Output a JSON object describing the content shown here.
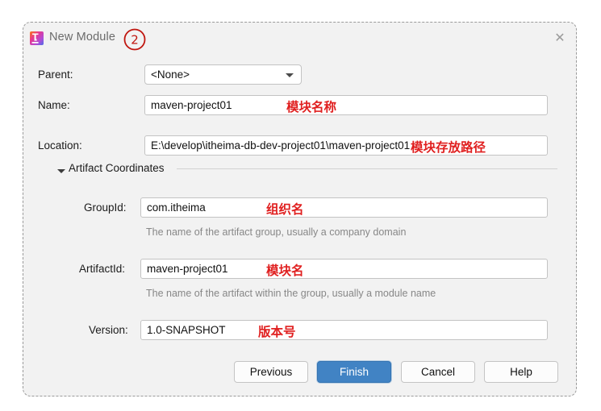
{
  "dialog": {
    "title": "New Module",
    "app_icon": "intellij-idea-icon",
    "close_icon": "close-icon",
    "step_badge": "2"
  },
  "fields": {
    "parent": {
      "label": "Parent:",
      "value": "<None>",
      "dropdown_icon": "chevron-down-icon"
    },
    "name": {
      "label": "Name:",
      "value": "maven-project01",
      "annotation": "模块名称"
    },
    "location": {
      "label": "Location:",
      "value": "E:\\develop\\itheima-db-dev-project01\\maven-project01",
      "annotation": "模块存放路径"
    }
  },
  "artifact_section": {
    "title": "Artifact Coordinates",
    "toggle_icon": "triangle-down-icon",
    "group_id": {
      "label": "GroupId:",
      "value": "com.itheima",
      "annotation": "组织名",
      "hint": "The name of the artifact group, usually a company domain"
    },
    "artifact_id": {
      "label": "ArtifactId:",
      "value": "maven-project01",
      "annotation": "模块名",
      "hint": "The name of the artifact within the group, usually a module name"
    },
    "version": {
      "label": "Version:",
      "value": "1.0-SNAPSHOT",
      "annotation": "版本号"
    }
  },
  "buttons": {
    "previous": "Previous",
    "finish": "Finish",
    "cancel": "Cancel",
    "help": "Help"
  },
  "colors": {
    "primary": "#4183c4",
    "annotation": "#e02020",
    "dialog_bg": "#f2f2f2"
  }
}
